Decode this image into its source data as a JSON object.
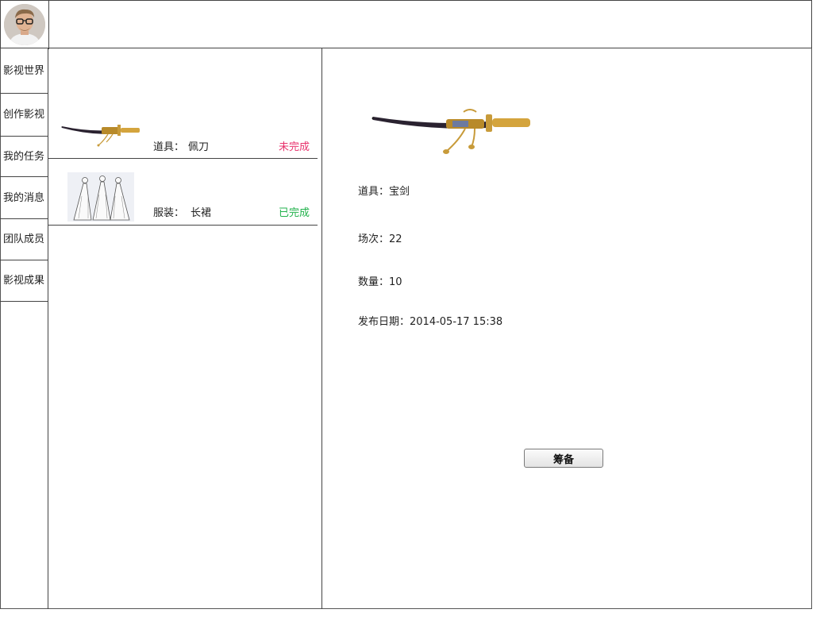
{
  "sidebar": {
    "items": [
      {
        "label": "影视世界"
      },
      {
        "label": "创作影视"
      },
      {
        "label": "我的任务"
      },
      {
        "label": "我的消息"
      },
      {
        "label": "团队成员"
      },
      {
        "label": "影视成果"
      }
    ]
  },
  "tasks": [
    {
      "type": "道具：",
      "name": "佩刀",
      "status": "未完成",
      "status_color": "#e8336d",
      "image": "sword-image"
    },
    {
      "type": "服装：",
      "name": "长裙",
      "status": "已完成",
      "status_color": "#22b24c",
      "image": "dress-sketch-image"
    }
  ],
  "detail": {
    "image": "sword-image",
    "prop": "道具：宝剑",
    "scene": "场次：22",
    "quantity": "数量：10",
    "publish_date": "发布日期：2014-05-17 15:38",
    "button_label": "筹备"
  }
}
